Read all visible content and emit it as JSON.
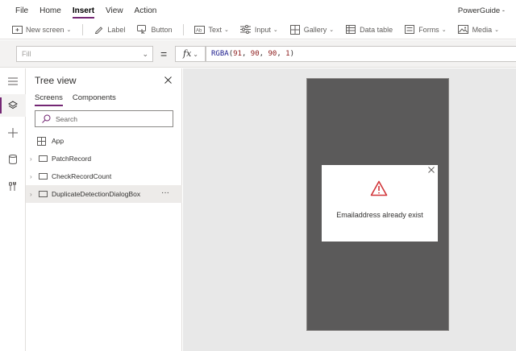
{
  "menubar": {
    "items": [
      "File",
      "Home",
      "Insert",
      "View",
      "Action"
    ],
    "active": "Insert",
    "app_title": "PowerGuide -"
  },
  "ribbon": {
    "new_screen": "New screen",
    "label": "Label",
    "button": "Button",
    "text": "Text",
    "input": "Input",
    "gallery": "Gallery",
    "data_table": "Data table",
    "forms": "Forms",
    "media": "Media"
  },
  "formula": {
    "property": "Fill",
    "equals": "=",
    "fx": "fx",
    "fn": "RGBA",
    "args": [
      "91",
      "90",
      "90",
      "1"
    ]
  },
  "tree": {
    "title": "Tree view",
    "tabs": [
      "Screens",
      "Components"
    ],
    "active_tab": "Screens",
    "search_placeholder": "Search",
    "app_label": "App",
    "screens": [
      {
        "name": "PatchRecord",
        "selected": false
      },
      {
        "name": "CheckRecordCount",
        "selected": false
      },
      {
        "name": "DuplicateDetectionDialogBox",
        "selected": true
      }
    ],
    "more": "···"
  },
  "canvas": {
    "screen_fill": "#5B5A5A",
    "dialog_message": "Emailaddress already exist"
  },
  "colors": {
    "accent": "#742774",
    "warning": "#D13438"
  }
}
